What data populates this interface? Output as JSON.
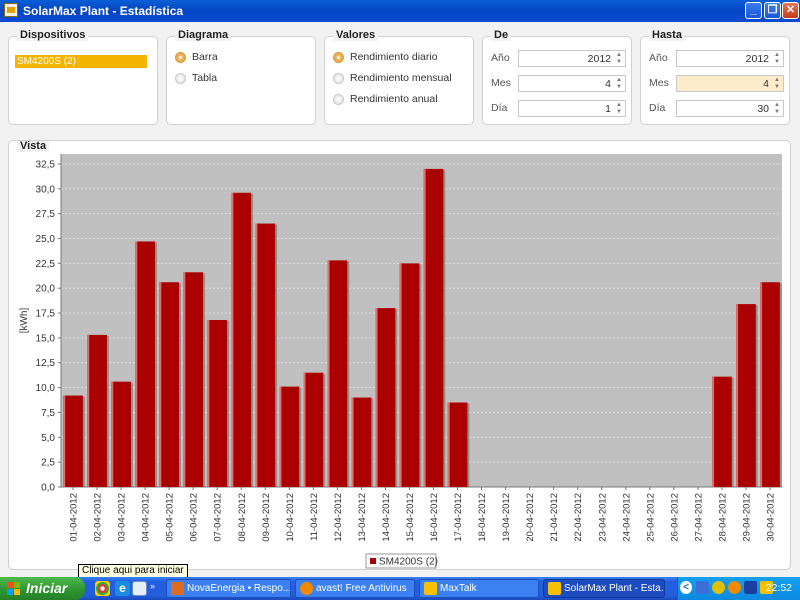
{
  "window": {
    "title": "SolarMax Plant - Estadística"
  },
  "dispositivos": {
    "title": "Dispositivos",
    "items": [
      "SM4200S (2)"
    ]
  },
  "diagrama": {
    "title": "Diagrama",
    "options": [
      {
        "label": "Barra",
        "selected": true
      },
      {
        "label": "Tabla",
        "selected": false
      }
    ]
  },
  "valores": {
    "title": "Valores",
    "options": [
      {
        "label": "Rendimiento diario",
        "selected": true
      },
      {
        "label": "Rendimiento mensual",
        "selected": false
      },
      {
        "label": "Rendimiento anual",
        "selected": false
      }
    ]
  },
  "de": {
    "title": "De",
    "anio_label": "Año",
    "anio": "2012",
    "mes_label": "Mes",
    "mes": "4",
    "dia_label": "Día",
    "dia": "1"
  },
  "hasta": {
    "title": "Hasta",
    "anio_label": "Año",
    "anio": "2012",
    "mes_label": "Mes",
    "mes": "4",
    "dia_label": "Día",
    "dia": "30"
  },
  "vista": {
    "title": "Vista"
  },
  "chart_data": {
    "type": "bar",
    "ylabel": "[kWh]",
    "ylim": [
      0,
      33.5
    ],
    "yticks": [
      "0,0",
      "2,5",
      "5,0",
      "7,5",
      "10,0",
      "12,5",
      "15,0",
      "17,5",
      "20,0",
      "22,5",
      "25,0",
      "27,5",
      "30,0",
      "32,5"
    ],
    "grid": true,
    "legend_position": "bottom-center",
    "bar_color": "#aa0000",
    "plot_bg": "#c0c0c0",
    "categories": [
      "01-04-2012",
      "02-04-2012",
      "03-04-2012",
      "04-04-2012",
      "05-04-2012",
      "06-04-2012",
      "07-04-2012",
      "08-04-2012",
      "09-04-2012",
      "10-04-2012",
      "11-04-2012",
      "12-04-2012",
      "13-04-2012",
      "14-04-2012",
      "15-04-2012",
      "16-04-2012",
      "17-04-2012",
      "18-04-2012",
      "19-04-2012",
      "20-04-2012",
      "21-04-2012",
      "22-04-2012",
      "23-04-2012",
      "24-04-2012",
      "25-04-2012",
      "26-04-2012",
      "27-04-2012",
      "28-04-2012",
      "29-04-2012",
      "30-04-2012"
    ],
    "series": [
      {
        "name": "SM4200S (2)",
        "values": [
          9.2,
          15.3,
          10.6,
          24.7,
          20.6,
          21.6,
          16.8,
          29.6,
          26.5,
          10.1,
          11.5,
          22.8,
          9.0,
          18.0,
          22.5,
          32.0,
          8.5,
          0,
          0,
          0,
          0,
          0,
          0,
          0,
          0,
          0,
          0,
          11.1,
          18.4,
          20.6
        ]
      }
    ]
  },
  "taskbar": {
    "start_label": "Iniciar",
    "tooltip": "Clique aqui para iniciar",
    "tasks": [
      {
        "label": "NovaEnergia • Respo...",
        "icon_color": "#e06a20"
      },
      {
        "label": "avast! Free Antivirus",
        "icon_color": "#f08a00"
      },
      {
        "label": "MaxTalk",
        "icon_color": "#f5c000"
      },
      {
        "label": "SolarMax Plant - Esta...",
        "icon_color": "#f5c000"
      }
    ],
    "clock": "22:52"
  }
}
